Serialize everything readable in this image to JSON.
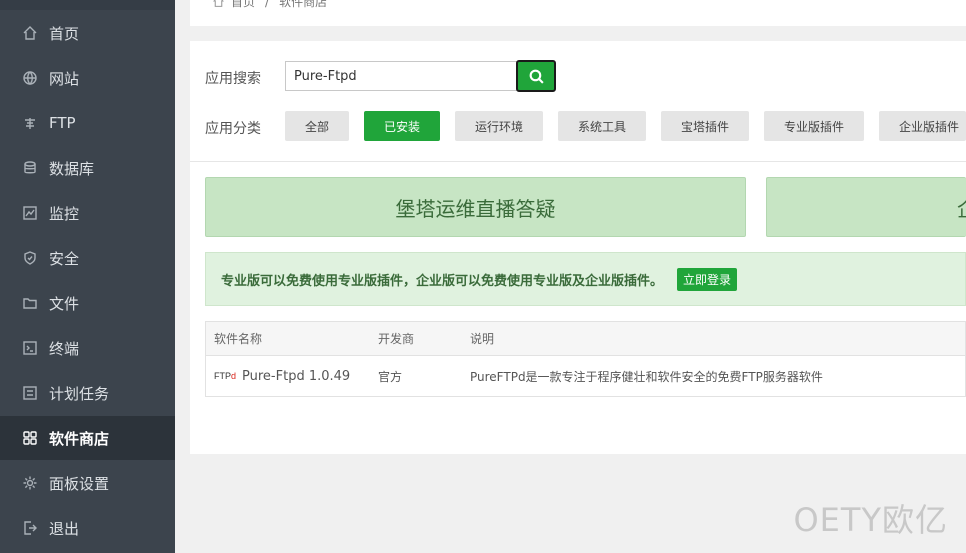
{
  "sidebar": {
    "items": [
      {
        "label": "首页",
        "icon": "home-icon"
      },
      {
        "label": "网站",
        "icon": "globe-icon"
      },
      {
        "label": "FTP",
        "icon": "ftp-icon"
      },
      {
        "label": "数据库",
        "icon": "database-icon"
      },
      {
        "label": "监控",
        "icon": "monitor-icon"
      },
      {
        "label": "安全",
        "icon": "shield-icon"
      },
      {
        "label": "文件",
        "icon": "folder-icon"
      },
      {
        "label": "终端",
        "icon": "terminal-icon"
      },
      {
        "label": "计划任务",
        "icon": "list-icon"
      },
      {
        "label": "软件商店",
        "icon": "grid-icon",
        "active": true
      },
      {
        "label": "面板设置",
        "icon": "gear-icon"
      },
      {
        "label": "退出",
        "icon": "logout-icon"
      }
    ]
  },
  "breadcrumb": {
    "home": "首页",
    "separator": "/",
    "current": "软件商店"
  },
  "search": {
    "label": "应用搜索",
    "value": "Pure-Ftpd"
  },
  "categories": {
    "label": "应用分类",
    "items": [
      "全部",
      "已安装",
      "运行环境",
      "系统工具",
      "宝塔插件",
      "专业版插件",
      "企业版插件"
    ],
    "active": "已安装"
  },
  "banners": [
    "堡塔运维直播答疑",
    "企"
  ],
  "notice": {
    "text": "专业版可以免费使用专业版插件，企业版可以免费使用专业版及企业版插件。",
    "button": "立即登录"
  },
  "table": {
    "headers": [
      "软件名称",
      "开发商",
      "说明"
    ],
    "rows": [
      {
        "logo_text": "FTP",
        "logo_mark": "d",
        "name": "Pure-Ftpd 1.0.49",
        "vendor": "官方",
        "description": "PureFTPd是一款专注于程序健壮和软件安全的免费FTP服务器软件"
      }
    ]
  },
  "watermark": "OETY欧亿",
  "colors": {
    "accent": "#20a53a",
    "sidebar": "#3c444d",
    "banner": "#c7e5c4"
  }
}
